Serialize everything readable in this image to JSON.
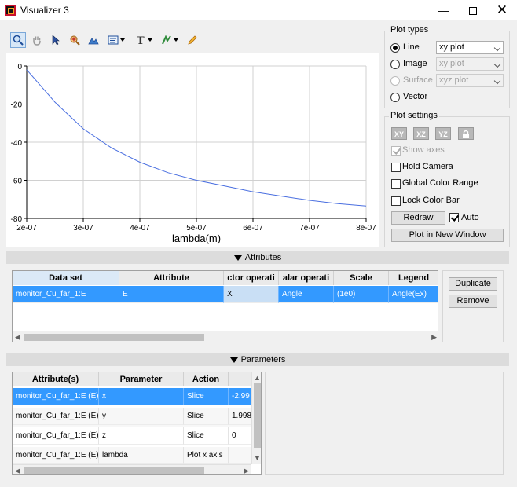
{
  "window": {
    "title": "Visualizer 3"
  },
  "plot": {
    "xlabel": "lambda(m)",
    "x_ticks": [
      "2e-07",
      "3e-07",
      "4e-07",
      "5e-07",
      "6e-07",
      "7e-07",
      "8e-07"
    ],
    "y_ticks": [
      "0",
      "-20",
      "-40",
      "-60",
      "-80"
    ]
  },
  "chart_data": {
    "type": "line",
    "xlabel": "lambda(m)",
    "ylabel": "",
    "xlim": [
      2e-07,
      8e-07
    ],
    "ylim": [
      -80,
      0
    ],
    "grid": true,
    "series": [
      {
        "color": "#4a6fe0",
        "x": [
          2e-07,
          2.5e-07,
          3e-07,
          3.5e-07,
          4e-07,
          4.5e-07,
          5e-07,
          5.5e-07,
          6e-07,
          6.5e-07,
          7e-07,
          7.5e-07,
          8e-07
        ],
        "y": [
          -2,
          -19,
          -33,
          -43,
          -50.5,
          -56,
          -60,
          -63,
          -66,
          -68.3,
          -70.5,
          -72.3,
          -73.5
        ]
      }
    ]
  },
  "plot_types": {
    "title": "Plot types",
    "options": [
      {
        "label": "Line",
        "select": "xy plot",
        "selected": true,
        "enabled": true
      },
      {
        "label": "Image",
        "select": "xy plot",
        "selected": false,
        "enabled": true
      },
      {
        "label": "Surface",
        "select": "xyz plot",
        "selected": false,
        "enabled": false
      },
      {
        "label": "Vector",
        "selected": false,
        "enabled": true
      }
    ]
  },
  "plot_settings": {
    "title": "Plot settings",
    "axis_buttons": [
      "XY",
      "XZ",
      "YZ"
    ],
    "show_axes": "Show axes",
    "hold_camera": "Hold Camera",
    "global_color_range": "Global Color Range",
    "lock_color_bar": "Lock Color Bar",
    "redraw": "Redraw",
    "auto": "Auto",
    "plot_new_window": "Plot in New Window"
  },
  "attributes": {
    "header": "Attributes",
    "columns": [
      "Data set",
      "Attribute",
      "ctor operati",
      "alar operati",
      "Scale",
      "Legend"
    ],
    "rows": [
      [
        "monitor_Cu_far_1:E",
        "E",
        "X",
        "Angle",
        "(1e0)",
        "Angle(Ex)"
      ]
    ],
    "duplicate": "Duplicate",
    "remove": "Remove"
  },
  "parameters": {
    "header": "Parameters",
    "columns": [
      "Attribute(s)",
      "Parameter",
      "Action",
      ""
    ],
    "rows": [
      [
        "monitor_Cu_far_1:E (E)",
        "x",
        "Slice",
        "-2.99"
      ],
      [
        "monitor_Cu_far_1:E (E)",
        "y",
        "Slice",
        "1.998"
      ],
      [
        "monitor_Cu_far_1:E (E)",
        "z",
        "Slice",
        "0"
      ],
      [
        "monitor_Cu_far_1:E (E)",
        "lambda",
        "Plot x axis",
        ""
      ]
    ]
  }
}
